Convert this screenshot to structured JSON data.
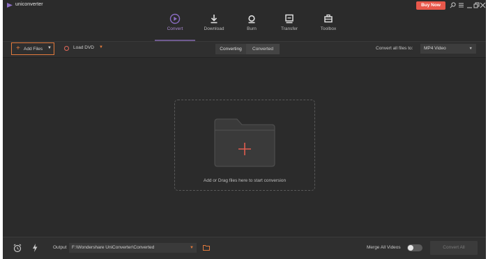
{
  "app": {
    "title": "uniconverter",
    "buy_now": "Buy Now"
  },
  "colors": {
    "accent": "#7b5fa8",
    "highlight": "#e27a3c",
    "buy_now_bg": "#e8584b",
    "background": "#2b2b2b"
  },
  "window_controls": [
    "search-icon",
    "menu-icon",
    "minimize-icon",
    "restore-icon",
    "close-icon"
  ],
  "nav": {
    "items": [
      {
        "label": "Convert",
        "icon": "convert-icon",
        "active": true
      },
      {
        "label": "Download",
        "icon": "download-icon",
        "active": false
      },
      {
        "label": "Burn",
        "icon": "burn-icon",
        "active": false
      },
      {
        "label": "Transfer",
        "icon": "transfer-icon",
        "active": false
      },
      {
        "label": "Toolbox",
        "icon": "toolbox-icon",
        "active": false
      }
    ]
  },
  "toolbar": {
    "add_files": "Add Files",
    "load_dvd": "Load DVD",
    "tabs": [
      "Converting",
      "Converted"
    ],
    "convert_all_label": "Convert all files to:",
    "format": "MP4 Video"
  },
  "drop_zone": {
    "text": "Add or Drag files here to start conversion"
  },
  "bottom": {
    "output_label": "Output",
    "output_path": "F:\\Wondershare UniConverter\\Converted",
    "merge_label": "Merge All Videos",
    "merge_enabled": false,
    "convert_all_button": "Convert All"
  }
}
